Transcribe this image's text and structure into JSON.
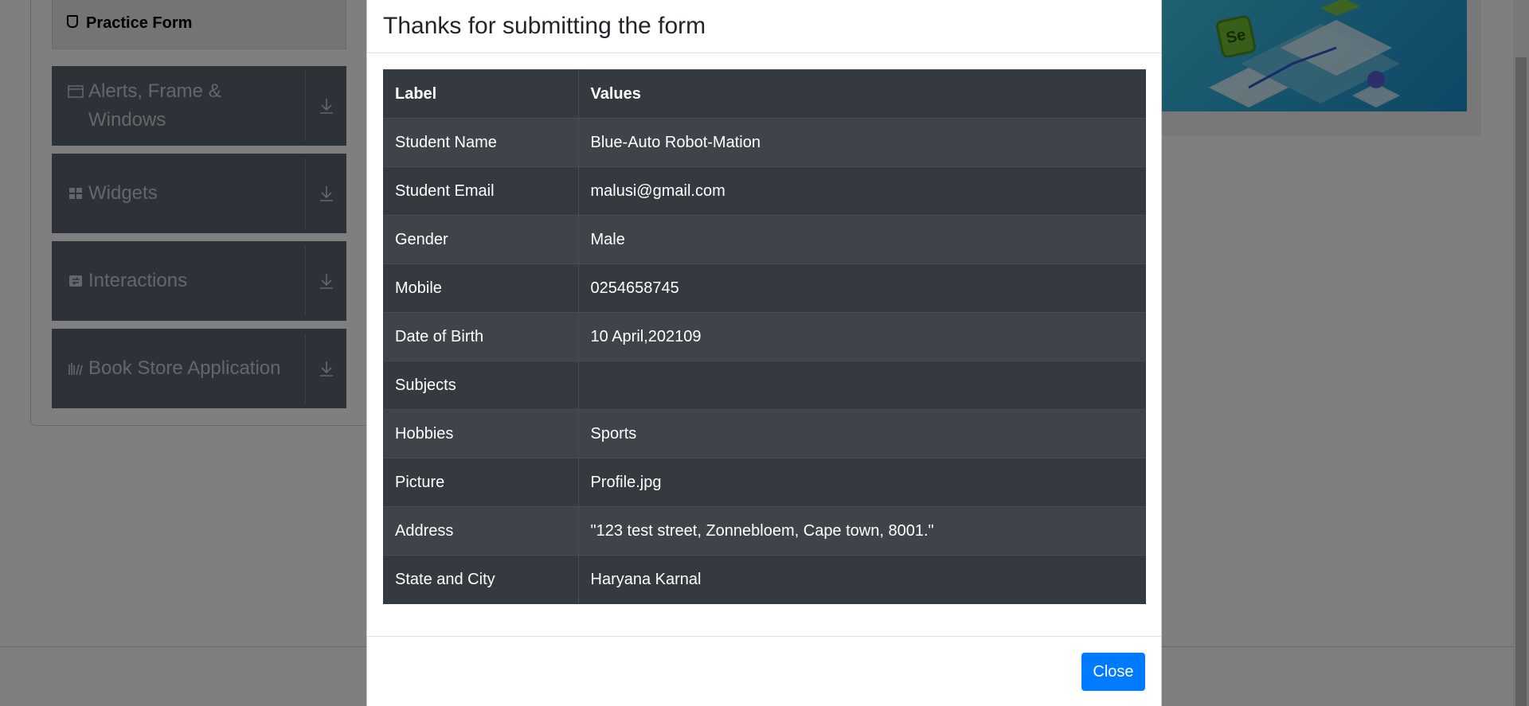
{
  "sidebar": {
    "practice_form": "Practice Form",
    "groups": [
      {
        "label": "Alerts, Frame & Windows",
        "icon": "window-icon"
      },
      {
        "label": "Widgets",
        "icon": "widgets-icon"
      },
      {
        "label": "Interactions",
        "icon": "interactions-icon"
      },
      {
        "label": "Book Store Application",
        "icon": "books-icon"
      }
    ]
  },
  "banner": {
    "badge": "Se"
  },
  "modal": {
    "title": "Thanks for submitting the form",
    "table": {
      "headers": [
        "Label",
        "Values"
      ],
      "rows": [
        [
          "Student Name",
          "Blue-Auto Robot-Mation"
        ],
        [
          "Student Email",
          "malusi@gmail.com"
        ],
        [
          "Gender",
          "Male"
        ],
        [
          "Mobile",
          "0254658745"
        ],
        [
          "Date of Birth",
          "10 April,202109"
        ],
        [
          "Subjects",
          ""
        ],
        [
          "Hobbies",
          "Sports"
        ],
        [
          "Picture",
          "Profile.jpg"
        ],
        [
          "Address",
          "\"123 test street, Zonnebloem, Cape town, 8001.\""
        ],
        [
          "State and City",
          "Haryana Karnal"
        ]
      ]
    },
    "close_label": "Close"
  },
  "colors": {
    "table_bg": "#343a40",
    "accent": "#007bff",
    "overlay": "rgba(0,0,0,0.5)"
  }
}
